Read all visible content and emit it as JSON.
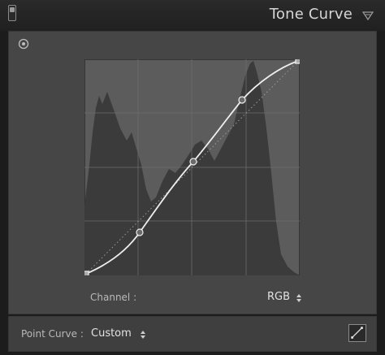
{
  "header": {
    "title": "Tone Curve"
  },
  "curve": {
    "channel_label": "Channel :",
    "channel_value": "RGB",
    "point_curve_label": "Point Curve :",
    "point_curve_value": "Custom"
  },
  "icons": {
    "panel_toggle": "panel-toggle-icon",
    "collapse": "triangle-down-icon",
    "target": "target-adjust-icon",
    "stepper": "updown-arrows-icon",
    "edit_curve": "diagonal-line-icon"
  },
  "colors": {
    "panel_bg": "#464646",
    "graph_bg": "#5c5c5c",
    "histogram": "#3b3b3b",
    "curve": "#eeeeee"
  }
}
